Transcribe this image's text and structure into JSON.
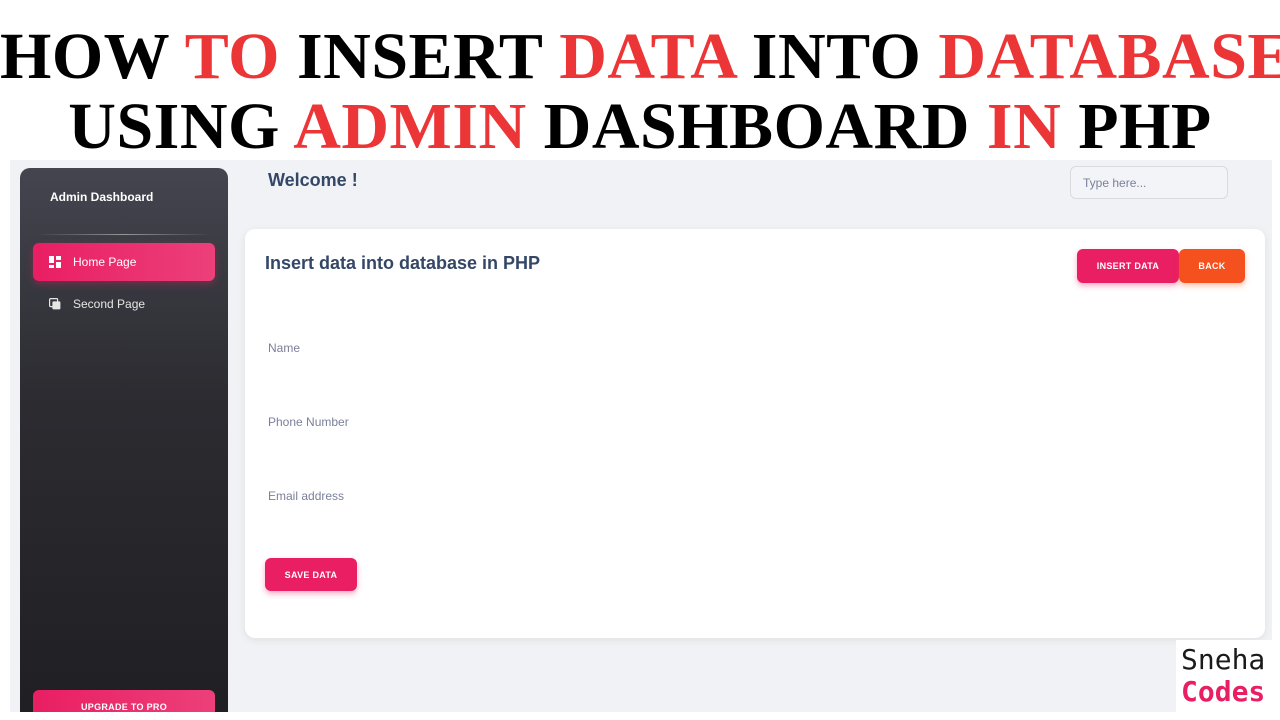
{
  "headline": {
    "line1": [
      {
        "text": "HOW ",
        "color": "black"
      },
      {
        "text": "TO ",
        "color": "red"
      },
      {
        "text": "INSERT ",
        "color": "black"
      },
      {
        "text": "DATA ",
        "color": "red"
      },
      {
        "text": "INTO ",
        "color": "black"
      },
      {
        "text": "DATABASE",
        "color": "red"
      }
    ],
    "line2": [
      {
        "text": "USING ",
        "color": "black"
      },
      {
        "text": "ADMIN ",
        "color": "red"
      },
      {
        "text": "DASHBOARD ",
        "color": "black"
      },
      {
        "text": "IN ",
        "color": "red"
      },
      {
        "text": "PHP",
        "color": "black"
      }
    ]
  },
  "colors": {
    "headline_red": "#ec3536",
    "accent_pink": "#e91e63",
    "back_orange": "#f4511e",
    "text_dark": "#344767",
    "watermark_pink": "#e91e63"
  },
  "sidebar": {
    "brand": "Admin Dashboard",
    "items": [
      {
        "label": "Home Page",
        "icon": "dashboard-grid-icon",
        "active": true
      },
      {
        "label": "Second Page",
        "icon": "copy-pages-icon",
        "active": false
      }
    ],
    "upgrade_label": "UPGRADE TO PRO"
  },
  "header": {
    "welcome": "Welcome !",
    "search_placeholder": "Type here..."
  },
  "card": {
    "title": "Insert data into database in PHP",
    "insert_label": "INSERT DATA",
    "back_label": "BACK",
    "fields": {
      "name_label": "Name",
      "name_value": "",
      "phone_label": "Phone Number",
      "phone_value": "",
      "email_label": "Email address",
      "email_value": ""
    },
    "save_label": "SAVE DATA"
  },
  "watermark": {
    "line1": "Sneha",
    "line2": "Codes"
  }
}
